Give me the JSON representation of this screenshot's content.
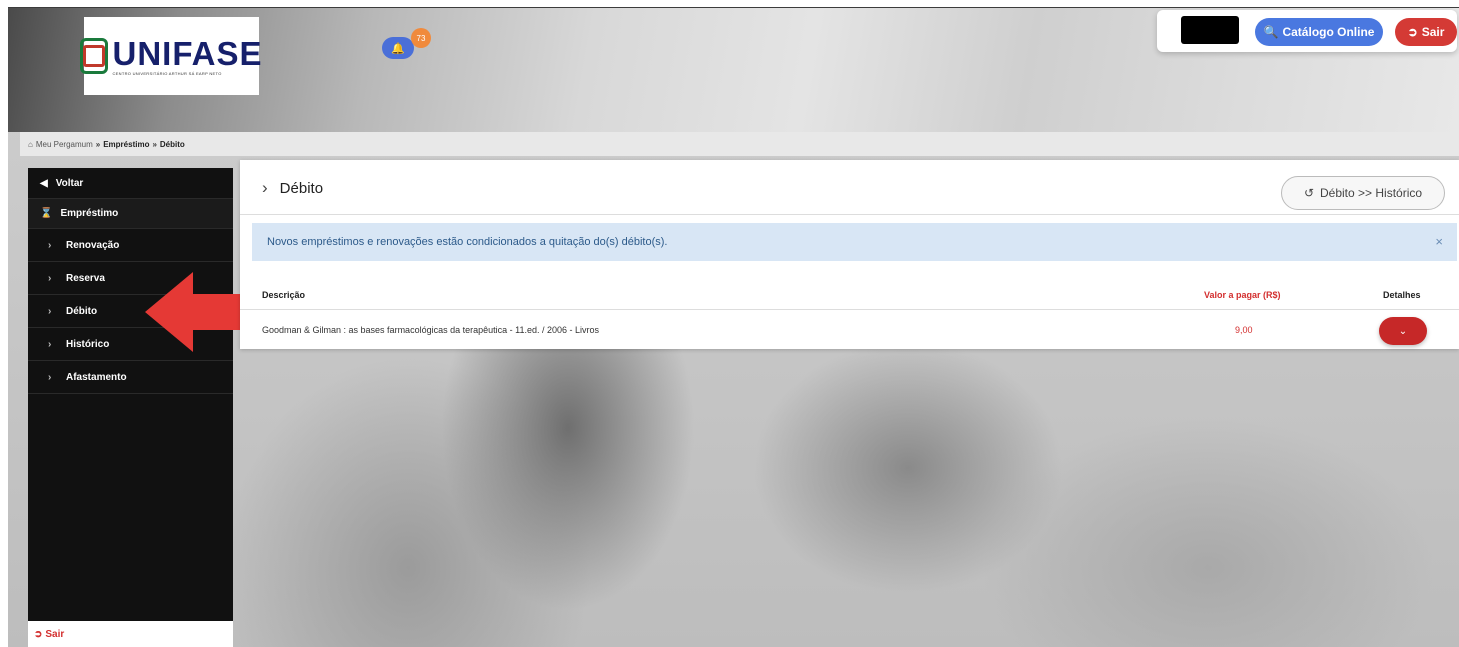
{
  "header": {
    "logo_text": "UNIFASE",
    "logo_subtitle": "CENTRO UNIVERSITÁRIO ARTHUR SÁ EARP NETO",
    "notification_count": "73",
    "catalogo_label": "Catálogo Online",
    "sair_label": "Sair"
  },
  "breadcrumb": {
    "home": "Meu Pergamum",
    "sep": "»",
    "level1": "Empréstimo",
    "level2": "Débito"
  },
  "sidebar": {
    "voltar": "Voltar",
    "section": "Empréstimo",
    "items": [
      {
        "label": "Renovação"
      },
      {
        "label": "Reserva"
      },
      {
        "label": "Débito"
      },
      {
        "label": "Histórico"
      },
      {
        "label": "Afastamento"
      }
    ],
    "footer": "Sair"
  },
  "main": {
    "title": "Débito",
    "historico_button": "Débito >> Histórico",
    "alert": "Novos empréstimos e renovações estão condicionados a quitação do(s) débito(s).",
    "alert_close": "×",
    "table": {
      "headers": {
        "descricao": "Descrição",
        "valor": "Valor a pagar (R$)",
        "detalhes": "Detalhes"
      },
      "rows": [
        {
          "descricao": "Goodman & Gilman : as bases farmacológicas da terapêutica - 11.ed. / 2006 - Livros",
          "valor": "9,00"
        }
      ]
    }
  },
  "colors": {
    "primary_blue": "#4a78e0",
    "danger_red": "#d43a35",
    "alert_bg": "#d8e6f5",
    "sidebar_bg": "#111111"
  }
}
